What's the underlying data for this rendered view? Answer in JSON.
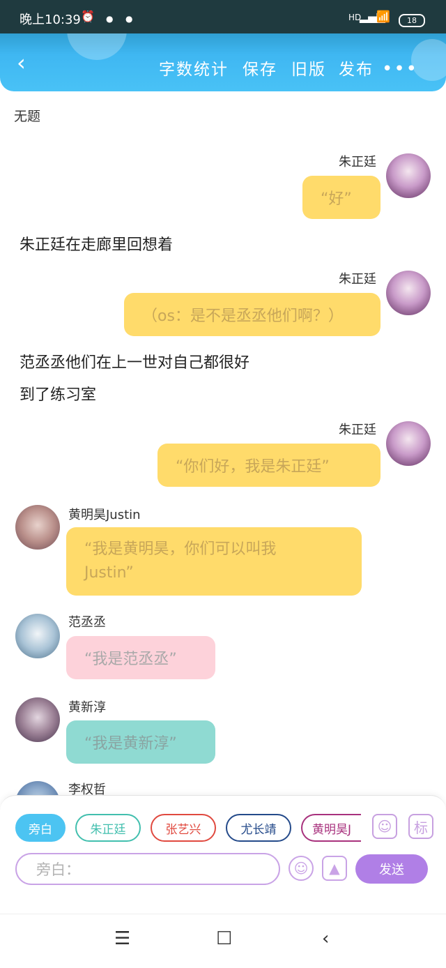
{
  "status": {
    "time": "晚上10:39",
    "network": "HD",
    "battery": "18"
  },
  "header": {
    "buttons": [
      "字数统计",
      "保存",
      "旧版",
      "发布"
    ],
    "more": "•••"
  },
  "doc_title": "无题",
  "messages": [
    {
      "kind": "right",
      "name": "朱正廷",
      "text": "“好”"
    },
    {
      "kind": "narration",
      "text": "朱正廷在走廊里回想着"
    },
    {
      "kind": "right",
      "name": "朱正廷",
      "text": "（os：是不是丞丞他们啊？）"
    },
    {
      "kind": "narration",
      "text": "范丞丞他们在上一世对自己都很好"
    },
    {
      "kind": "narration",
      "text": "到了练习室"
    },
    {
      "kind": "right",
      "name": "朱正廷",
      "text": "“你们好，我是朱正廷”"
    },
    {
      "kind": "left",
      "name": "黄明昊Justin",
      "text_line1": "“我是黄明昊，你们可以叫我",
      "text_line2": "Justin”"
    },
    {
      "kind": "left",
      "name": "范丞丞",
      "text": "“我是范丞丞”"
    },
    {
      "kind": "left",
      "name": "黄新淳",
      "text": "“我是黄新淳”"
    },
    {
      "kind": "left",
      "name": "李权哲",
      "text": ""
    }
  ],
  "composer": {
    "chips": [
      "旁白",
      "朱正廷",
      "张艺兴",
      "尤长靖",
      "黄明昊J"
    ],
    "icons": [
      "person-icon",
      "标"
    ],
    "input_placeholder": "旁白：",
    "send_label": "发送"
  },
  "navbar": {
    "menu": "☰",
    "home": "☐",
    "back": "‹"
  },
  "colors": {
    "header": "#3fb7f2",
    "yellow_bubble": "#ffdb6b",
    "pink_bubble": "#fdd2da",
    "teal_bubble": "#8fdad2",
    "send": "#b07fe6",
    "chip_narrator": "#4cc4f2"
  }
}
